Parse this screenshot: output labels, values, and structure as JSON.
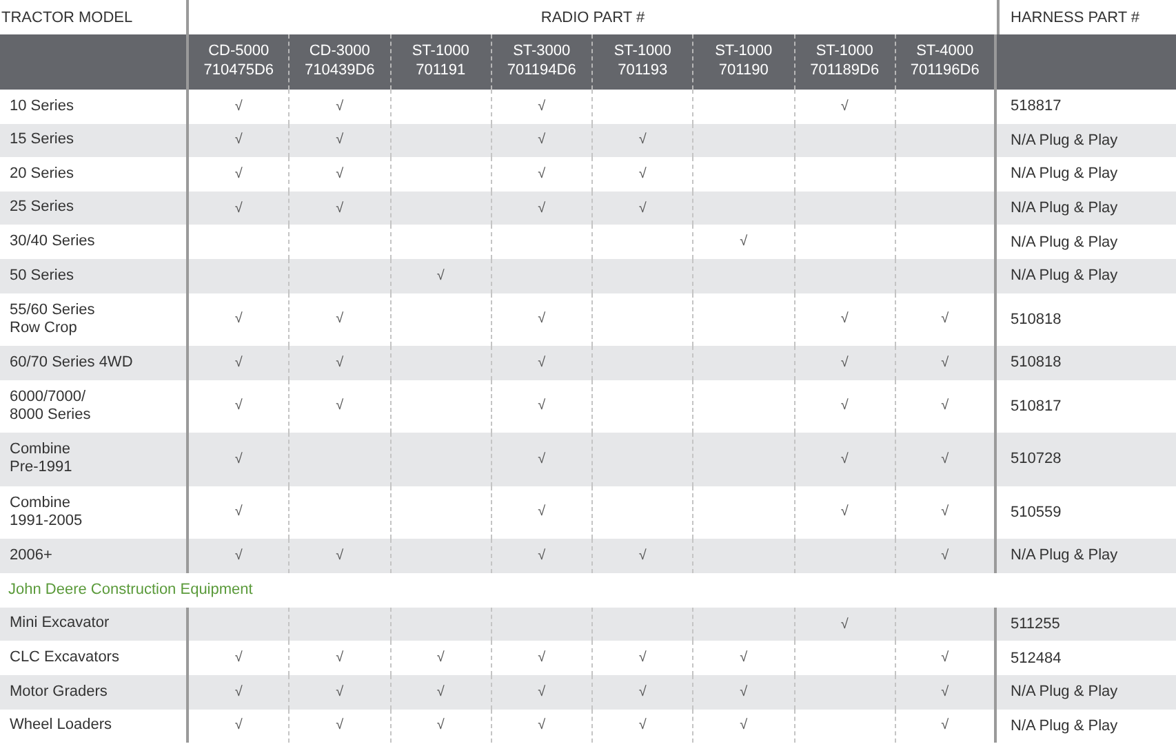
{
  "header": {
    "model": "TRACTOR MODEL",
    "radio": "RADIO PART #",
    "harness": "HARNESS PART #"
  },
  "radio_columns": [
    {
      "model": "CD-5000",
      "part": "710475D6"
    },
    {
      "model": "CD-3000",
      "part": "710439D6"
    },
    {
      "model": "ST-1000",
      "part": "701191"
    },
    {
      "model": "ST-3000",
      "part": "701194D6"
    },
    {
      "model": "ST-1000",
      "part": "701193"
    },
    {
      "model": "ST-1000",
      "part": "701190"
    },
    {
      "model": "ST-1000",
      "part": "701189D6"
    },
    {
      "model": "ST-4000",
      "part": "701196D6"
    }
  ],
  "sections": [
    {
      "rows": [
        {
          "model": "10 Series",
          "checks": {
            "radio_1": "√",
            "radio_2": "√",
            "radio_4": "√",
            "radio_7": "√"
          },
          "harness": "518817",
          "shaded": false
        },
        {
          "model": "15 Series",
          "checks": {
            "radio_1": "√",
            "radio_2": "√",
            "radio_4": "√",
            "radio_5": "√"
          },
          "harness": "N/A Plug & Play",
          "shaded": true
        },
        {
          "model": "20 Series",
          "checks": {
            "radio_1": "√",
            "radio_2": "√",
            "radio_4": "√",
            "radio_5": "√"
          },
          "harness": "N/A Plug & Play",
          "shaded": false
        },
        {
          "model": "25 Series",
          "checks": {
            "radio_1": "√",
            "radio_2": "√",
            "radio_4": "√",
            "radio_5": "√"
          },
          "harness": "N/A Plug & Play",
          "shaded": true
        },
        {
          "model": "30/40 Series",
          "checks": {
            "radio_6": "√"
          },
          "harness": "N/A Plug & Play",
          "shaded": false
        },
        {
          "model": "50 Series",
          "checks": {
            "radio_3": "√"
          },
          "harness": "N/A Plug & Play",
          "shaded": true
        },
        {
          "model": "55/60 Series\nRow Crop",
          "checks": {
            "radio_1": "√",
            "radio_2": "√",
            "radio_4": "√",
            "radio_7": "√",
            "radio_8": "√"
          },
          "harness": "510818",
          "shaded": false
        },
        {
          "model": "60/70 Series 4WD",
          "checks": {
            "radio_1": "√",
            "radio_2": "√",
            "radio_4": "√",
            "radio_7": "√",
            "radio_8": "√"
          },
          "harness": "510818",
          "shaded": true
        },
        {
          "model": "6000/7000/\n8000 Series",
          "checks": {
            "radio_1": "√",
            "radio_2": "√",
            "radio_4": "√",
            "radio_7": "√",
            "radio_8": "√"
          },
          "harness": "510817",
          "shaded": false
        },
        {
          "model": "Combine\nPre-1991",
          "checks": {
            "radio_1": "√",
            "radio_4": "√",
            "radio_7": "√",
            "radio_8": "√"
          },
          "harness": "510728",
          "shaded": true
        },
        {
          "model": "Combine\n1991-2005",
          "checks": {
            "radio_1": "√",
            "radio_4": "√",
            "radio_7": "√",
            "radio_8": "√"
          },
          "harness": "510559",
          "shaded": false
        },
        {
          "model": "2006+",
          "checks": {
            "radio_1": "√",
            "radio_2": "√",
            "radio_4": "√",
            "radio_5": "√",
            "radio_8": "√"
          },
          "harness": "N/A Plug & Play",
          "shaded": true
        }
      ]
    },
    {
      "title": "John Deere Construction Equipment",
      "rows": [
        {
          "model": "Mini Excavator",
          "checks": {
            "radio_7": "√"
          },
          "harness": "511255",
          "shaded": true
        },
        {
          "model": "CLC Excavators",
          "checks": {
            "radio_1": "√",
            "radio_2": "√",
            "radio_3": "√",
            "radio_4": "√",
            "radio_5": "√",
            "radio_6": "√",
            "radio_8": "√"
          },
          "harness": "512484",
          "shaded": false
        },
        {
          "model": "Motor Graders",
          "checks": {
            "radio_1": "√",
            "radio_2": "√",
            "radio_3": "√",
            "radio_4": "√",
            "radio_5": "√",
            "radio_6": "√",
            "radio_8": "√"
          },
          "harness": "N/A Plug & Play",
          "shaded": true
        },
        {
          "model": "Wheel Loaders",
          "checks": {
            "radio_1": "√",
            "radio_2": "√",
            "radio_3": "√",
            "radio_4": "√",
            "radio_5": "√",
            "radio_6": "√",
            "radio_8": "√"
          },
          "harness": "N/A Plug & Play",
          "shaded": false
        }
      ]
    }
  ]
}
